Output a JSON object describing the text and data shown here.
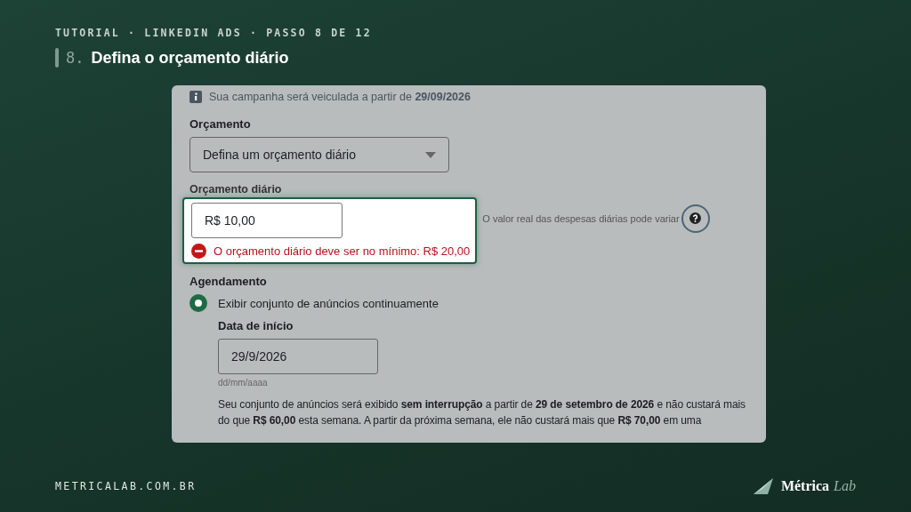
{
  "header": {
    "breadcrumb": "TUTORIAL · LINKEDIN ADS · PASSO 8 DE 12",
    "step_number": "8.",
    "title": "Defina o orçamento diário"
  },
  "panel": {
    "info": "Sua campanha será veiculada a partir de **29/09/2026**",
    "budget": {
      "label": "Orçamento",
      "select_value": "Defina um orçamento diário"
    },
    "daily_budget": {
      "label": "Orçamento diário",
      "value": "R$ 10,00",
      "helper": "O valor real das despesas diárias pode variar",
      "error": "O orçamento diário deve ser no mínimo: R$ 20,00",
      "highlighted": true
    },
    "scheduling": {
      "label": "Agendamento",
      "option": {
        "label": "Exibir conjunto de anúncios continuamente",
        "selected": true
      },
      "start_date": {
        "label": "Data de início",
        "value": "29/9/2026",
        "hint": "dd/mm/aaaa"
      },
      "summary": "Seu conjunto de anúncios será exibido **sem interrupção** a partir de **29 de setembro de 2026** e não custará mais do que **R$ 60,00** esta semana. A partir da próxima semana, ele não custará mais que **R$ 70,00** em uma"
    }
  },
  "footer": {
    "site": "METRICALAB.COM.BR",
    "logo": {
      "primary": "Métrica",
      "secondary": "Lab"
    }
  }
}
